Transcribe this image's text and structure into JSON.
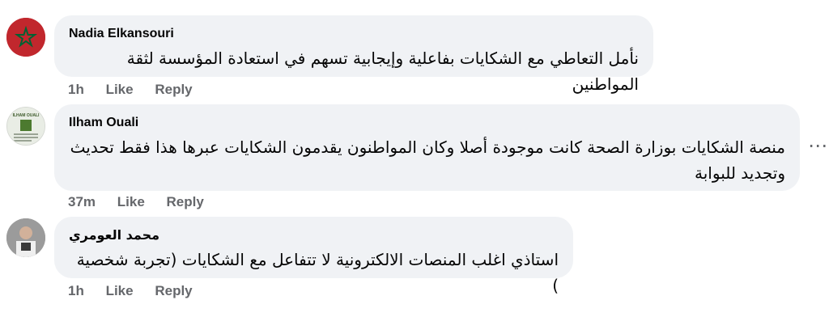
{
  "comments": [
    {
      "author": "Nadia Elkansouri",
      "text": "نأمل التعاطي مع الشكايات بفاعلية وإيجابية تسهم في استعادة المؤسسة لثقة المواطنين",
      "time": "1h",
      "like": "Like",
      "reply": "Reply"
    },
    {
      "author": "Ilham Ouali",
      "text": "منصة الشكايات بوزارة الصحة كانت موجودة أصلا وكان المواطنون يقدمون الشكايات عبرها هذا فقط تحديث وتجديد للبوابة",
      "time": "37m",
      "like": "Like",
      "reply": "Reply",
      "avatar_text": "ILHAM OUALI"
    },
    {
      "author": "محمد العومري",
      "text": "استاذي اغلب المنصات الالكترونية لا تتفاعل مع الشكايات (تجربة شخصية )",
      "time": "1h",
      "like": "Like",
      "reply": "Reply"
    }
  ],
  "more_options": "⋯"
}
